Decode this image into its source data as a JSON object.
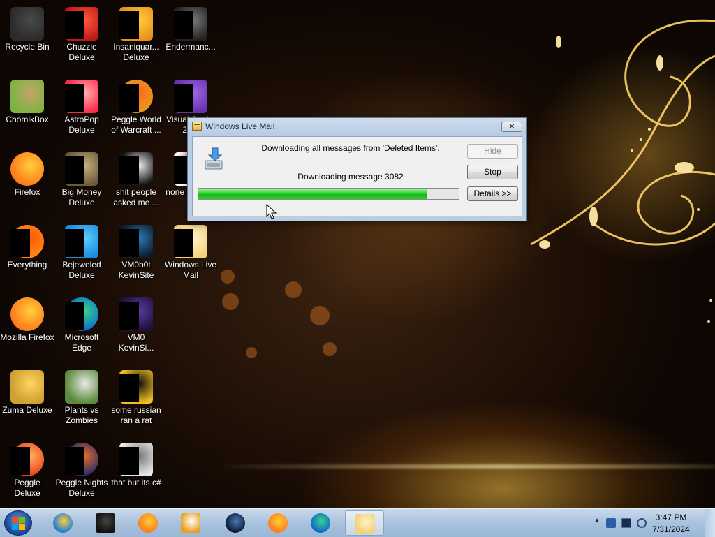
{
  "desktop": {
    "icons": [
      {
        "label": "Recycle Bin",
        "icon": "recycle-bin-icon"
      },
      {
        "label": "Chuzzle Deluxe",
        "icon": "chuzzle-icon"
      },
      {
        "label": "Insaniquar... Deluxe",
        "icon": "insaniquarium-icon"
      },
      {
        "label": "Endermanc...",
        "icon": "endermanch-icon"
      },
      {
        "label": "ChomikBox",
        "icon": "chomikbox-icon"
      },
      {
        "label": "AstroPop Deluxe",
        "icon": "astropop-icon"
      },
      {
        "label": "Peggle World of Warcraft ...",
        "icon": "peggle-wow-icon"
      },
      {
        "label": "Visual Studio 20...",
        "icon": "visual-studio-icon"
      },
      {
        "label": "Firefox",
        "icon": "firefox-icon"
      },
      {
        "label": "Big Money Deluxe",
        "icon": "big-money-icon"
      },
      {
        "label": "shit people asked me ...",
        "icon": "folder-icon"
      },
      {
        "label": "none retard...",
        "icon": "none-icon"
      },
      {
        "label": "Everything",
        "icon": "everything-icon"
      },
      {
        "label": "Bejeweled Deluxe",
        "icon": "bejeweled-icon"
      },
      {
        "label": "VM0b0t KevinSite",
        "icon": "vm0b0t-icon"
      },
      {
        "label": "Windows Live Mail",
        "icon": "windows-live-mail-icon"
      },
      {
        "label": "Mozilla Firefox",
        "icon": "firefox-icon"
      },
      {
        "label": "Microsoft Edge",
        "icon": "edge-icon"
      },
      {
        "label": "VM0 KevinSi...",
        "icon": "vm0-icon"
      },
      {
        "label": "Zuma Deluxe",
        "icon": "zuma-icon"
      },
      {
        "label": "Plants vs Zombies",
        "icon": "plants-vs-zombies-icon"
      },
      {
        "label": "some russian ran a rat",
        "icon": "document-icon"
      },
      {
        "label": "Peggle Deluxe",
        "icon": "peggle-icon"
      },
      {
        "label": "Peggle Nights Deluxe",
        "icon": "peggle-nights-icon"
      },
      {
        "label": "that but its c#",
        "icon": "shortcut-icon"
      }
    ]
  },
  "dialog": {
    "title": "Windows Live Mail",
    "close_label": "✕",
    "message": "Downloading all messages from 'Deleted Items'.",
    "status": "Downloading message 3082",
    "progress": 0.88,
    "buttons": {
      "hide": "Hide",
      "stop": "Stop",
      "details": "Details >>"
    }
  },
  "taskbar": {
    "items": [
      {
        "icon": "internet-explorer-icon"
      },
      {
        "icon": "terminal-icon"
      },
      {
        "icon": "firefox-icon"
      },
      {
        "icon": "media-player-icon"
      },
      {
        "icon": "steam-icon"
      },
      {
        "icon": "firefox-icon"
      },
      {
        "icon": "edge-icon"
      },
      {
        "icon": "windows-live-mail-icon",
        "active": true
      }
    ],
    "clock": {
      "time": "3:47 PM",
      "date": "7/31/2024"
    }
  },
  "colors": {
    "progress_green": "#16b716",
    "dialog_frame": "#b9cde4",
    "taskbar": "#a9c2dd"
  }
}
